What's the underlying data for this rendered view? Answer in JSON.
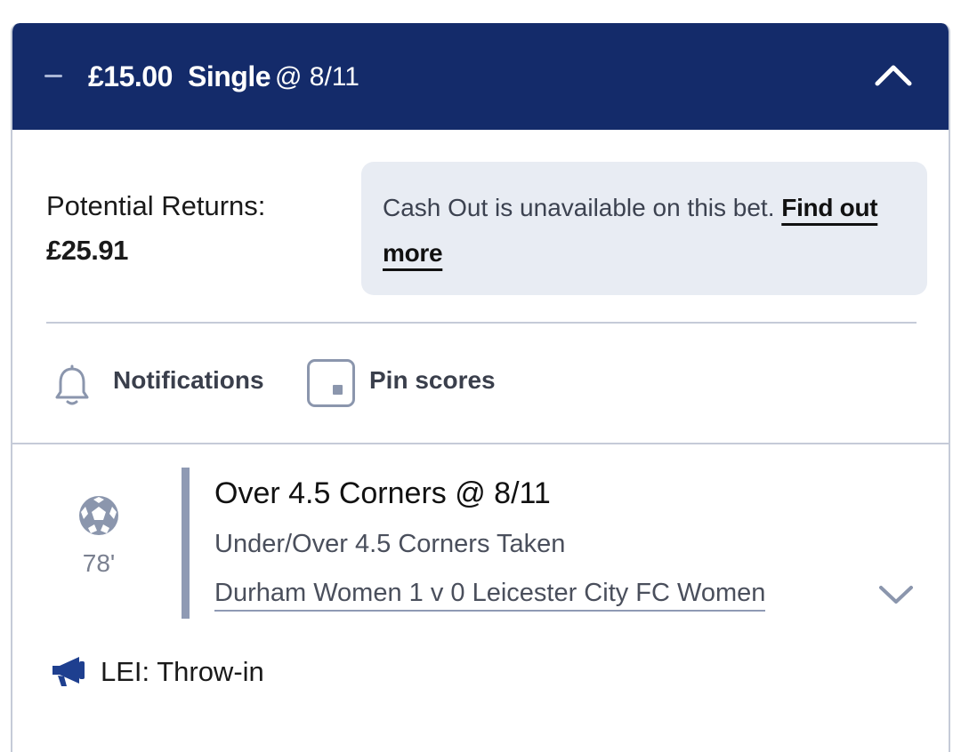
{
  "header": {
    "stake": "£15.00",
    "bet_type": "Single",
    "odds": "@ 8/11"
  },
  "returns": {
    "label": "Potential Returns:",
    "value": "£25.91"
  },
  "cashout": {
    "message": "Cash Out is unavailable on this bet. ",
    "link": "Find out more"
  },
  "actions": {
    "notifications_label": "Notifications",
    "pin_label": "Pin scores"
  },
  "selection": {
    "minute": "78'",
    "title": "Over 4.5 Corners @ 8/11",
    "market": "Under/Over 4.5 Corners Taken",
    "event": "Durham Women 1 v 0 Leicester City FC Women"
  },
  "commentary": {
    "text": "LEI: Throw-in"
  },
  "colors": {
    "header_bg": "#142b6a",
    "cashout_bg": "#e8ecf3",
    "accent": "#2a4a9a"
  },
  "icons": [
    "minus-icon",
    "chevron-up-icon",
    "bell-icon",
    "pin-icon",
    "football-icon",
    "chevron-down-icon",
    "megaphone-icon"
  ]
}
